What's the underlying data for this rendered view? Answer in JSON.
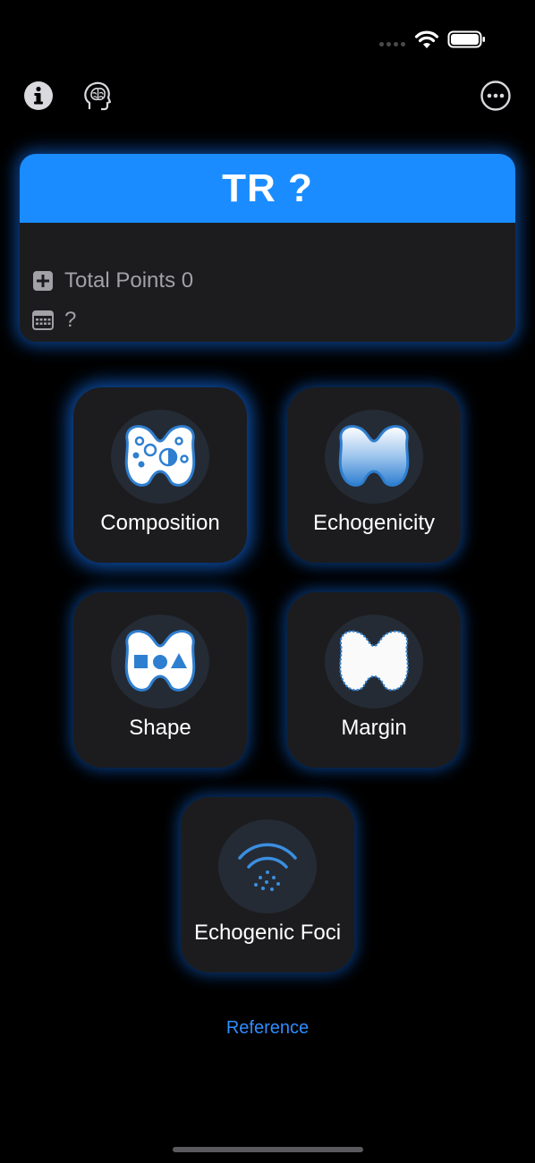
{
  "status_bar": {
    "signal_icon": "signal-dots-icon",
    "wifi_icon": "wifi-icon",
    "battery_icon": "battery-icon"
  },
  "nav": {
    "info_icon": "info-icon",
    "ai_icon": "brain-head-icon",
    "more_icon": "ellipsis-circle-icon"
  },
  "result": {
    "title": "TR ?",
    "points_label": "Total Points 0",
    "date_value": "?",
    "header_color": "#1a8cff"
  },
  "categories": [
    {
      "label": "Composition",
      "icon": "thyroid-composition-icon"
    },
    {
      "label": "Echogenicity",
      "icon": "thyroid-echogenicity-icon"
    },
    {
      "label": "Shape",
      "icon": "thyroid-shape-icon"
    },
    {
      "label": "Margin",
      "icon": "thyroid-margin-icon"
    },
    {
      "label": "Echogenic Foci",
      "icon": "echogenic-foci-icon"
    }
  ],
  "reference_link": "Reference",
  "colors": {
    "accent": "#2f8cff",
    "glow": "#1478ff",
    "card_bg": "#1c1c1e"
  }
}
